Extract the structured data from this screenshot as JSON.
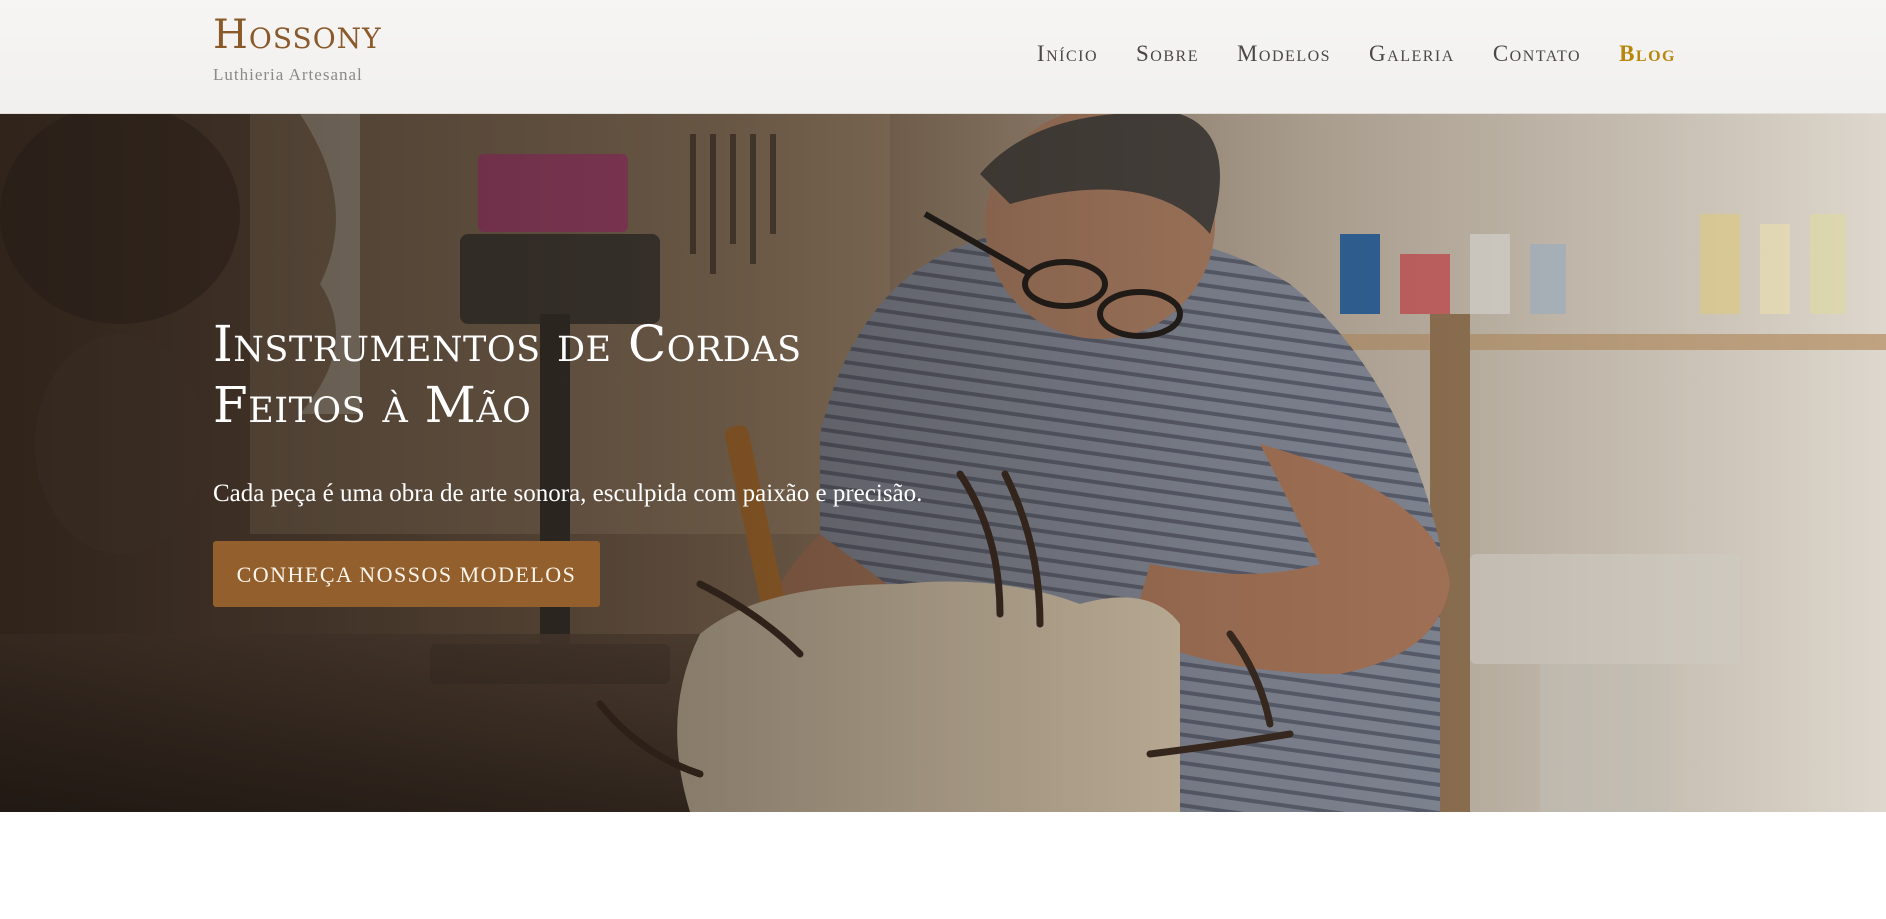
{
  "brand": {
    "name": "Hossony",
    "tagline": "Luthieria Artesanal",
    "color": "#8a5a2b"
  },
  "nav": {
    "items": [
      {
        "label": "Início"
      },
      {
        "label": "Sobre"
      },
      {
        "label": "Modelos"
      },
      {
        "label": "Galeria"
      },
      {
        "label": "Contato"
      },
      {
        "label": "Blog",
        "active": true
      }
    ],
    "active_color": "#b8860b"
  },
  "hero": {
    "title_line1": "Instrumentos de Cordas",
    "title_line2": "Feitos à Mão",
    "subtitle": "Cada peça é uma obra de arte sonora, esculpida com paixão e precisão.",
    "cta_label": "CONHEÇA NOSSOS MODELOS",
    "cta_color": "#93602d"
  }
}
